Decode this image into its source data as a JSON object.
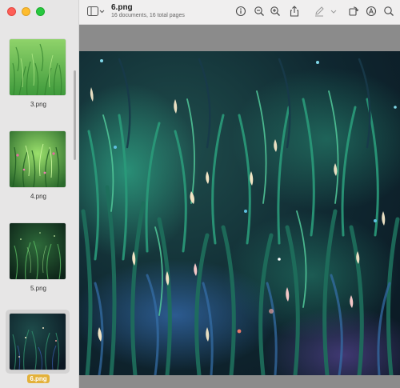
{
  "window": {
    "title": "6.png",
    "subtitle": "16 documents, 16 total pages"
  },
  "sidebar": {
    "thumbnails": [
      {
        "label": "3.png",
        "selected": false
      },
      {
        "label": "4.png",
        "selected": false
      },
      {
        "label": "5.png",
        "selected": false
      },
      {
        "label": "6.png",
        "selected": true
      }
    ]
  },
  "toolbar": {
    "icons": [
      "sidebar-toggle-icon",
      "info-icon",
      "zoom-out-icon",
      "zoom-in-icon",
      "share-icon",
      "markup-pen-icon",
      "chevron-down-icon",
      "rotate-icon",
      "annotate-icon",
      "search-icon"
    ]
  },
  "colors": {
    "close": "#fe5f57",
    "minimize": "#febc2e",
    "zoom": "#28c840",
    "selected_label": "#e3b13a"
  }
}
